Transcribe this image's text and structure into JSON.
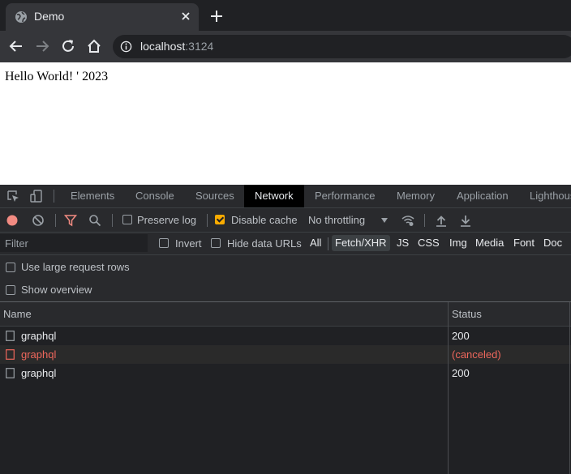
{
  "browser": {
    "tab_title": "Demo",
    "url_host": "localhost",
    "url_port": ":3124"
  },
  "page": {
    "text": "Hello World! ' 2023"
  },
  "devtools": {
    "tabs": [
      "Elements",
      "Console",
      "Sources",
      "Network",
      "Performance",
      "Memory",
      "Application",
      "Lighthouse"
    ],
    "active_tab": "Network",
    "toolbar": {
      "preserve_log_label": "Preserve log",
      "preserve_log_checked": false,
      "disable_cache_label": "Disable cache",
      "disable_cache_checked": true,
      "throttling": "No throttling"
    },
    "filter": {
      "placeholder": "Filter",
      "invert_label": "Invert",
      "hide_data_urls_label": "Hide data URLs",
      "types": [
        "All",
        "Fetch/XHR",
        "JS",
        "CSS",
        "Img",
        "Media",
        "Font",
        "Doc"
      ],
      "selected_type": "Fetch/XHR"
    },
    "options": {
      "large_rows_label": "Use large request rows",
      "show_overview_label": "Show overview"
    },
    "table": {
      "columns": [
        "Name",
        "Status"
      ],
      "rows": [
        {
          "name": "graphql",
          "status": "200",
          "error": false
        },
        {
          "name": "graphql",
          "status": "(canceled)",
          "error": true
        },
        {
          "name": "graphql",
          "status": "200",
          "error": false
        }
      ]
    },
    "colors": {
      "accent_checkbox": "#f9ab00",
      "record_red": "#f28b82",
      "error_text": "#ee675c",
      "filter_red": "#f28b82"
    }
  }
}
